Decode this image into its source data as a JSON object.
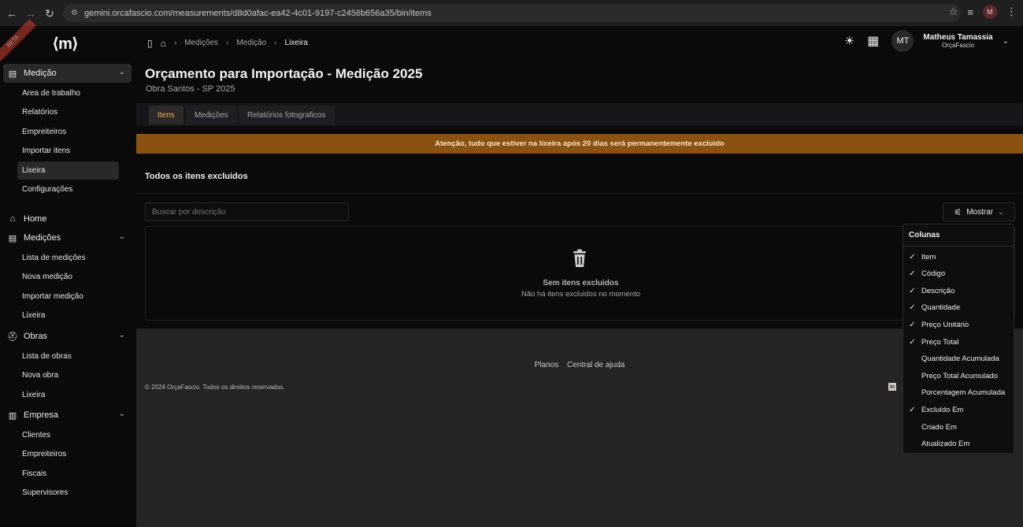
{
  "browser": {
    "url": "gemini.orcafascio.com/measurements/d8d0afac-ea42-4c01-9197-c2456b656a35/bin/items",
    "profile_initial": "M"
  },
  "sidebar": {
    "logo": "⟨m⟩",
    "groups": [
      {
        "label": "Medição",
        "icon": "document-icon",
        "expanded": true,
        "items": [
          "Area de trabalho",
          "Relatórios",
          "Empreiteiros",
          "Importar itens",
          "Lixeira",
          "Configurações"
        ],
        "active_item": "Lixeira"
      },
      {
        "label": "Home",
        "icon": "home-icon"
      },
      {
        "label": "Medições",
        "icon": "document-icon",
        "expanded": true,
        "items": [
          "Lista de medições",
          "Nova medição",
          "Importar medição",
          "Lixeira"
        ]
      },
      {
        "label": "Obras",
        "icon": "helmet-icon",
        "expanded": true,
        "items": [
          "Lista de obras",
          "Nova obra",
          "Lixeira"
        ]
      },
      {
        "label": "Empresa",
        "icon": "building-icon",
        "expanded": true,
        "items": [
          "Clientes",
          "Empreiteiros",
          "Fiscais",
          "Supervisores"
        ]
      }
    ]
  },
  "breadcrumb": [
    "Medições",
    "Medição",
    "Lixeira"
  ],
  "user": {
    "initials": "MT",
    "name": "Matheus Tamassia",
    "org": "OrçaFascio"
  },
  "page": {
    "title": "Orçamento para Importação - Medição 2025",
    "subtitle": "Obra Santos - SP 2025"
  },
  "tabs": [
    {
      "label": "Itens",
      "active": true
    },
    {
      "label": "Medições",
      "active": false
    },
    {
      "label": "Relatórios fotograficos",
      "active": false
    }
  ],
  "banner": "Atenção, tudo que estiver na lixeira após 20 dias será permanentemente excluido",
  "section": {
    "title": "Todos os itens excluidos",
    "search_placeholder": "Buscar por descrição",
    "show_label": "Mostrar",
    "empty_title": "Sem itens excluidos",
    "empty_desc": "Não há itens excluidos no momento"
  },
  "footer": {
    "links": [
      "Planos",
      "Central de ajuda"
    ],
    "copyright": "© 2024 OrçaFascio. Todos os direitos reservados."
  },
  "columns_menu": {
    "title": "Colunas",
    "items": [
      {
        "label": "Item",
        "checked": true
      },
      {
        "label": "Código",
        "checked": true
      },
      {
        "label": "Descrição",
        "checked": true
      },
      {
        "label": "Quantidade",
        "checked": true
      },
      {
        "label": "Preço Unitário",
        "checked": true
      },
      {
        "label": "Preço Total",
        "checked": true
      },
      {
        "label": "Quantidade Acumulada",
        "checked": false
      },
      {
        "label": "Preço Total Acumulado",
        "checked": false
      },
      {
        "label": "Porcentagem Acumulada",
        "checked": false
      },
      {
        "label": "Excluído Em",
        "checked": true
      },
      {
        "label": "Criado Em",
        "checked": false
      },
      {
        "label": "Atualizado Em",
        "checked": false
      }
    ]
  },
  "colors": {
    "accent": "#f0a84b",
    "banner_bg": "#8a5110",
    "page_bg": "#0b0a0a",
    "footer_bg": "#252323"
  }
}
